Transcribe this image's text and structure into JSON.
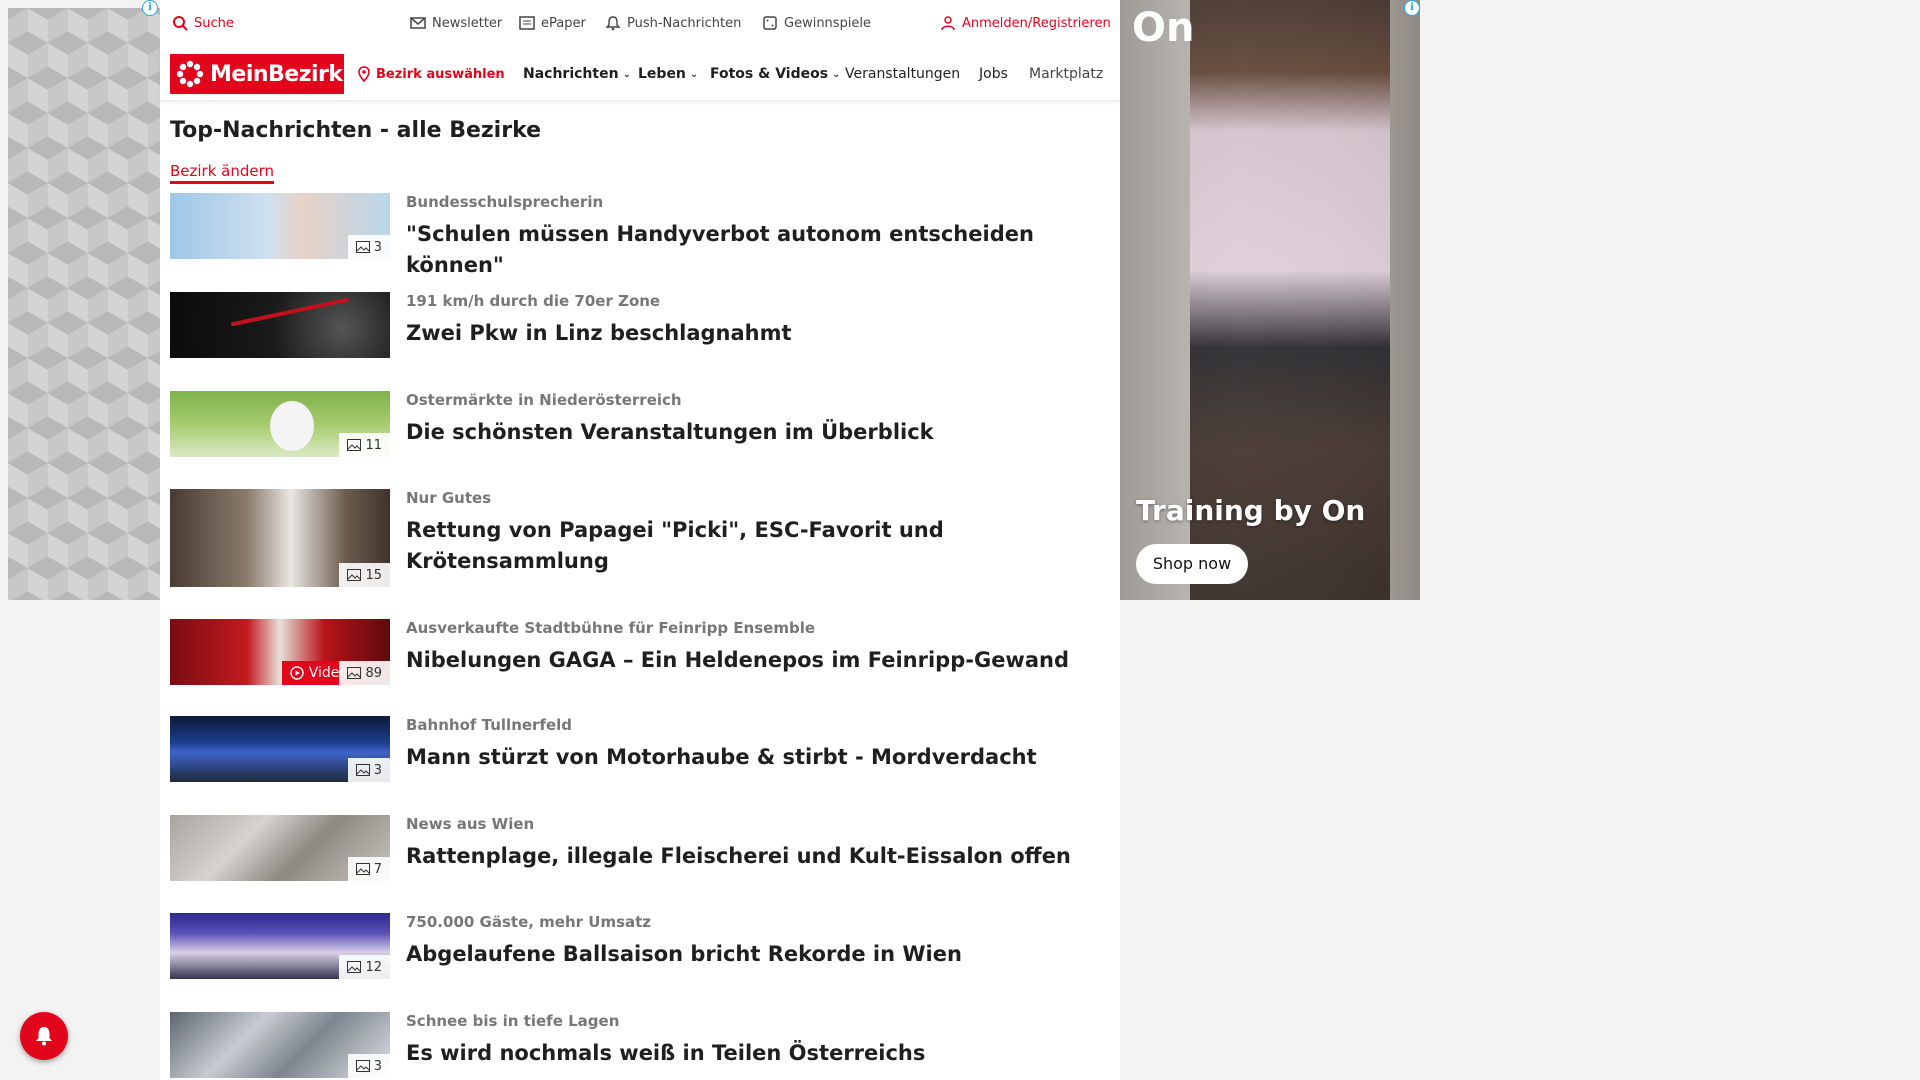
{
  "topbar": {
    "search": "Suche",
    "newsletter": "Newsletter",
    "epaper": "ePaper",
    "push": "Push-Nachrichten",
    "gewinnspiele": "Gewinnspiele",
    "login": "Anmelden/Registrieren"
  },
  "nav": {
    "logo": "MeinBezirk",
    "bezirk": "Bezirk auswählen",
    "items": [
      "Nachrichten",
      "Leben",
      "Fotos & Videos",
      "Veranstaltungen",
      "Jobs",
      "Marktplatz"
    ]
  },
  "page_title": "Top-Nachrichten - alle Bezirke",
  "change_bezirk": "Bezirk ändern",
  "articles": [
    {
      "kicker": "Bundesschulsprecherin",
      "headline": "\"Schulen müssen Handyverbot autonom entscheiden können\"",
      "count": "3"
    },
    {
      "kicker": "191 km/h durch die 70er Zone",
      "headline": "Zwei Pkw in Linz beschlagnahmt",
      "count": ""
    },
    {
      "kicker": "Ostermärkte in Niederösterreich",
      "headline": "Die schönsten Veranstaltungen im Überblick",
      "count": "11"
    },
    {
      "kicker": "Nur Gutes",
      "headline": "Rettung von Papagei \"Picki\", ESC-Favorit und Krötensammlung",
      "count": "15"
    },
    {
      "kicker": "Ausverkaufte Stadtbühne für Feinripp Ensemble",
      "headline": "Nibelungen GAGA – Ein Heldenepos im Feinripp-Gewand",
      "count": "89",
      "video": "Video"
    },
    {
      "kicker": "Bahnhof Tullnerfeld",
      "headline": "Mann stürzt von Motorhaube & stirbt - Mordverdacht",
      "count": "3"
    },
    {
      "kicker": "News aus Wien",
      "headline": "Rattenplage, illegale Fleischerei und Kult-Eissalon offen",
      "count": "7"
    },
    {
      "kicker": "750.000 Gäste, mehr Umsatz",
      "headline": "Abgelaufene Ballsaison bricht Rekorde in Wien",
      "count": "12"
    },
    {
      "kicker": "Schnee bis in tiefe Lagen",
      "headline": "Es wird nochmals weiß in Teilen Österreichs",
      "count": "3"
    }
  ],
  "ad_right": {
    "brand": "On",
    "headline": "Training by On",
    "cta": "Shop now"
  },
  "colors": {
    "brand_red": "#e3051b",
    "text": "#1f1f1f",
    "kicker": "#777777"
  }
}
